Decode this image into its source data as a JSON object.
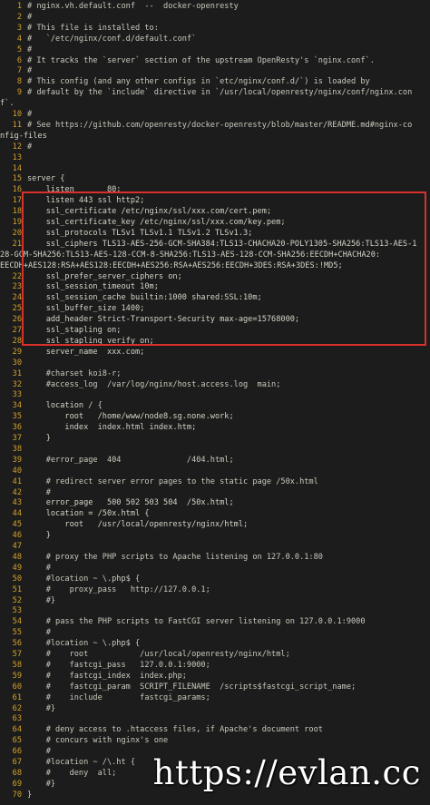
{
  "editor": {
    "lines": [
      {
        "num": "1",
        "text": "# nginx.vh.default.conf  --  docker-openresty"
      },
      {
        "num": "2",
        "text": "#"
      },
      {
        "num": "3",
        "text": "# This file is installed to:"
      },
      {
        "num": "4",
        "text": "#   `/etc/nginx/conf.d/default.conf`"
      },
      {
        "num": "5",
        "text": "#"
      },
      {
        "num": "6",
        "text": "# It tracks the `server` section of the upstream OpenResty's `nginx.conf`."
      },
      {
        "num": "7",
        "text": "#"
      },
      {
        "num": "8",
        "text": "# This config (and any other configs in `etc/nginx/conf.d/`) is loaded by"
      },
      {
        "num": "9",
        "text": "# default by the `include` directive in `/usr/local/openresty/nginx/conf/nginx.con"
      },
      {
        "num": "",
        "text": "f`."
      },
      {
        "num": "10",
        "text": "#"
      },
      {
        "num": "11",
        "text": "# See https://github.com/openresty/docker-openresty/blob/master/README.md#nginx-co"
      },
      {
        "num": "",
        "text": "nfig-files"
      },
      {
        "num": "12",
        "text": "#"
      },
      {
        "num": "13",
        "text": ""
      },
      {
        "num": "14",
        "text": ""
      },
      {
        "num": "15",
        "text": "server {"
      },
      {
        "num": "16",
        "text": "    listen       80;"
      },
      {
        "num": "17",
        "text": "    listen 443 ssl http2;"
      },
      {
        "num": "18",
        "text": "    ssl_certificate /etc/nginx/ssl/xxx.com/cert.pem;"
      },
      {
        "num": "19",
        "text": "    ssl_certificate_key /etc/nginx/ssl/xxx.com/key.pem;"
      },
      {
        "num": "20",
        "text": "    ssl_protocols TLSv1 TLSv1.1 TLSv1.2 TLSv1.3;"
      },
      {
        "num": "21",
        "text": "    ssl_ciphers TLS13-AES-256-GCM-SHA384:TLS13-CHACHA20-POLY1305-SHA256:TLS13-AES-1"
      },
      {
        "num": "",
        "text": "28-GCM-SHA256:TLS13-AES-128-CCM-8-SHA256:TLS13-AES-128-CCM-SHA256:EECDH+CHACHA20:"
      },
      {
        "num": "",
        "text": "EECDH+AES128:RSA+AES128:EECDH+AES256:RSA+AES256:EECDH+3DES:RSA+3DES:!MD5;"
      },
      {
        "num": "22",
        "text": "    ssl_prefer_server_ciphers on;"
      },
      {
        "num": "23",
        "text": "    ssl_session_timeout 10m;"
      },
      {
        "num": "24",
        "text": "    ssl_session_cache builtin:1000 shared:SSL:10m;"
      },
      {
        "num": "25",
        "text": "    ssl_buffer_size 1400;"
      },
      {
        "num": "26",
        "text": "    add_header Strict-Transport-Security max-age=15768000;"
      },
      {
        "num": "27",
        "text": "    ssl_stapling on;"
      },
      {
        "num": "28",
        "text": "    ssl_stapling_verify on;"
      },
      {
        "num": "29",
        "text": "    server_name  xxx.com;"
      },
      {
        "num": "30",
        "text": ""
      },
      {
        "num": "31",
        "text": "    #charset koi8-r;"
      },
      {
        "num": "32",
        "text": "    #access_log  /var/log/nginx/host.access.log  main;"
      },
      {
        "num": "33",
        "text": ""
      },
      {
        "num": "34",
        "text": "    location / {"
      },
      {
        "num": "35",
        "text": "        root   /home/www/node8.sg.none.work;"
      },
      {
        "num": "36",
        "text": "        index  index.html index.htm;"
      },
      {
        "num": "37",
        "text": "    }"
      },
      {
        "num": "38",
        "text": ""
      },
      {
        "num": "39",
        "text": "    #error_page  404              /404.html;"
      },
      {
        "num": "40",
        "text": ""
      },
      {
        "num": "41",
        "text": "    # redirect server error pages to the static page /50x.html"
      },
      {
        "num": "42",
        "text": "    #"
      },
      {
        "num": "43",
        "text": "    error_page   500 502 503 504  /50x.html;"
      },
      {
        "num": "44",
        "text": "    location = /50x.html {"
      },
      {
        "num": "45",
        "text": "        root   /usr/local/openresty/nginx/html;"
      },
      {
        "num": "46",
        "text": "    }"
      },
      {
        "num": "47",
        "text": ""
      },
      {
        "num": "48",
        "text": "    # proxy the PHP scripts to Apache listening on 127.0.0.1:80"
      },
      {
        "num": "49",
        "text": "    #"
      },
      {
        "num": "50",
        "text": "    #location ~ \\.php$ {"
      },
      {
        "num": "51",
        "text": "    #    proxy_pass   http://127.0.0.1;"
      },
      {
        "num": "52",
        "text": "    #}"
      },
      {
        "num": "53",
        "text": ""
      },
      {
        "num": "54",
        "text": "    # pass the PHP scripts to FastCGI server listening on 127.0.0.1:9000"
      },
      {
        "num": "55",
        "text": "    #"
      },
      {
        "num": "56",
        "text": "    #location ~ \\.php$ {"
      },
      {
        "num": "57",
        "text": "    #    root           /usr/local/openresty/nginx/html;"
      },
      {
        "num": "58",
        "text": "    #    fastcgi_pass   127.0.0.1:9000;"
      },
      {
        "num": "59",
        "text": "    #    fastcgi_index  index.php;"
      },
      {
        "num": "60",
        "text": "    #    fastcgi_param  SCRIPT_FILENAME  /scripts$fastcgi_script_name;"
      },
      {
        "num": "61",
        "text": "    #    include        fastcgi_params;"
      },
      {
        "num": "62",
        "text": "    #}"
      },
      {
        "num": "63",
        "text": ""
      },
      {
        "num": "64",
        "text": "    # deny access to .htaccess files, if Apache's document root"
      },
      {
        "num": "65",
        "text": "    # concurs with nginx's one"
      },
      {
        "num": "66",
        "text": "    #"
      },
      {
        "num": "67",
        "text": "    #location ~ /\\.ht {"
      },
      {
        "num": "68",
        "text": "    #    deny  all;"
      },
      {
        "num": "69",
        "text": "    #}"
      },
      {
        "num": "70",
        "text": "}"
      }
    ]
  },
  "watermark": "https://evlan.cc",
  "colors": {
    "background": "#1c1c1c",
    "line_number": "#d3a02a",
    "code_text": "#d4d4c8",
    "highlight_border": "#d8302b"
  }
}
